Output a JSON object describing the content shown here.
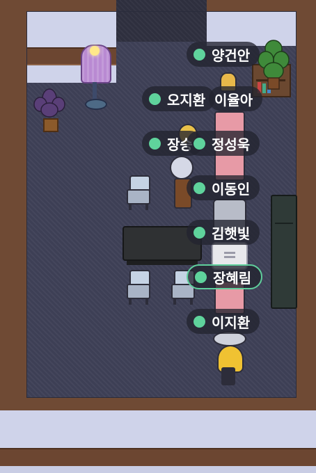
{
  "players": [
    {
      "name": "양건안"
    },
    {
      "name": "오지환"
    },
    {
      "name": "이율아"
    },
    {
      "name": "장승"
    },
    {
      "name": "정성욱"
    },
    {
      "name": "이동인"
    },
    {
      "name": "김햇빛"
    },
    {
      "name": "장혜림",
      "active": true
    },
    {
      "name": "이지환"
    }
  ],
  "colors": {
    "online_dot": "#5fd39c",
    "active_outline": "#5fcf9c",
    "floor": "#3d3f55",
    "wall": "#cfd3ea"
  }
}
